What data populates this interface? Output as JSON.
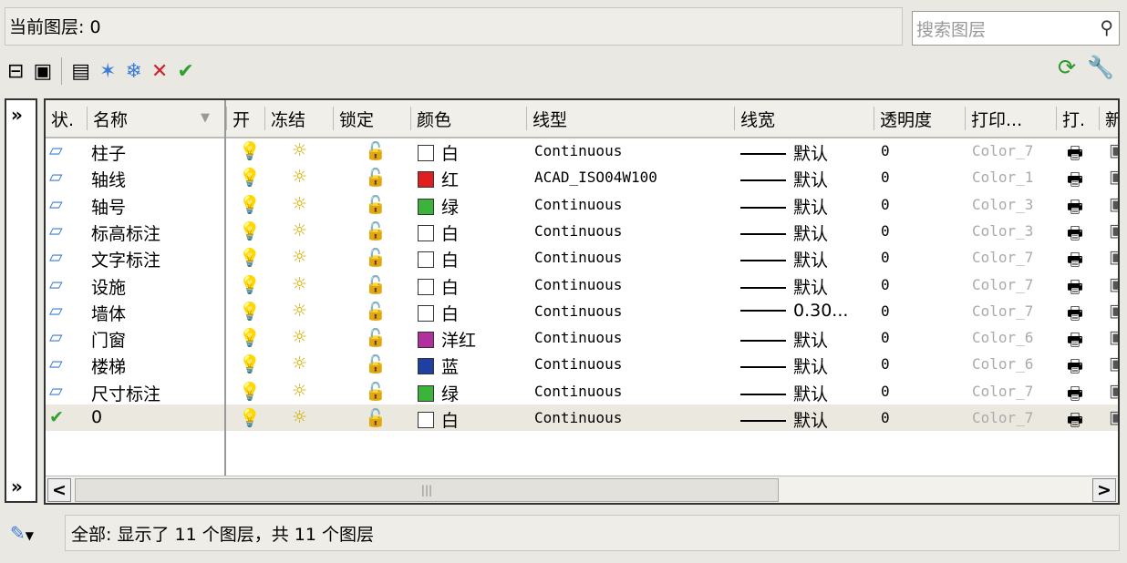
{
  "current_layer": "当前图层: 0",
  "search_placeholder": "搜索图层",
  "columns": [
    "状.",
    "名称",
    "开",
    "冻结",
    "锁定",
    "颜色",
    "线型",
    "线宽",
    "透明度",
    "打印...",
    "打.",
    "新"
  ],
  "colors": {
    "白": "#ffffff",
    "红": "#e02020",
    "绿": "#3cb43c",
    "洋红": "#b030a0",
    "蓝": "#2040a0"
  },
  "rows": [
    {
      "name": "柱子",
      "color": "白",
      "linetype": "Continuous",
      "lineweight": "默认",
      "transparency": "0",
      "plot_style": "Color_7"
    },
    {
      "name": "轴线",
      "color": "红",
      "linetype": "ACAD_ISO04W100",
      "lineweight": "默认",
      "transparency": "0",
      "plot_style": "Color_1"
    },
    {
      "name": "轴号",
      "color": "绿",
      "linetype": "Continuous",
      "lineweight": "默认",
      "transparency": "0",
      "plot_style": "Color_3"
    },
    {
      "name": "标高标注",
      "color": "白",
      "linetype": "Continuous",
      "lineweight": "默认",
      "transparency": "0",
      "plot_style": "Color_3"
    },
    {
      "name": "文字标注",
      "color": "白",
      "linetype": "Continuous",
      "lineweight": "默认",
      "transparency": "0",
      "plot_style": "Color_7"
    },
    {
      "name": "设施",
      "color": "白",
      "linetype": "Continuous",
      "lineweight": "默认",
      "transparency": "0",
      "plot_style": "Color_7"
    },
    {
      "name": "墙体",
      "color": "白",
      "linetype": "Continuous",
      "lineweight": "0.30...",
      "transparency": "0",
      "plot_style": "Color_7"
    },
    {
      "name": "门窗",
      "color": "洋红",
      "linetype": "Continuous",
      "lineweight": "默认",
      "transparency": "0",
      "plot_style": "Color_6"
    },
    {
      "name": "楼梯",
      "color": "蓝",
      "linetype": "Continuous",
      "lineweight": "默认",
      "transparency": "0",
      "plot_style": "Color_6"
    },
    {
      "name": "尺寸标注",
      "color": "绿",
      "linetype": "Continuous",
      "lineweight": "默认",
      "transparency": "0",
      "plot_style": "Color_7"
    },
    {
      "name": "0",
      "color": "白",
      "linetype": "Continuous",
      "lineweight": "默认",
      "transparency": "0",
      "plot_style": "Color_7",
      "current": true
    }
  ],
  "status": "全部: 显示了 11 个图层，共 11 个图层"
}
